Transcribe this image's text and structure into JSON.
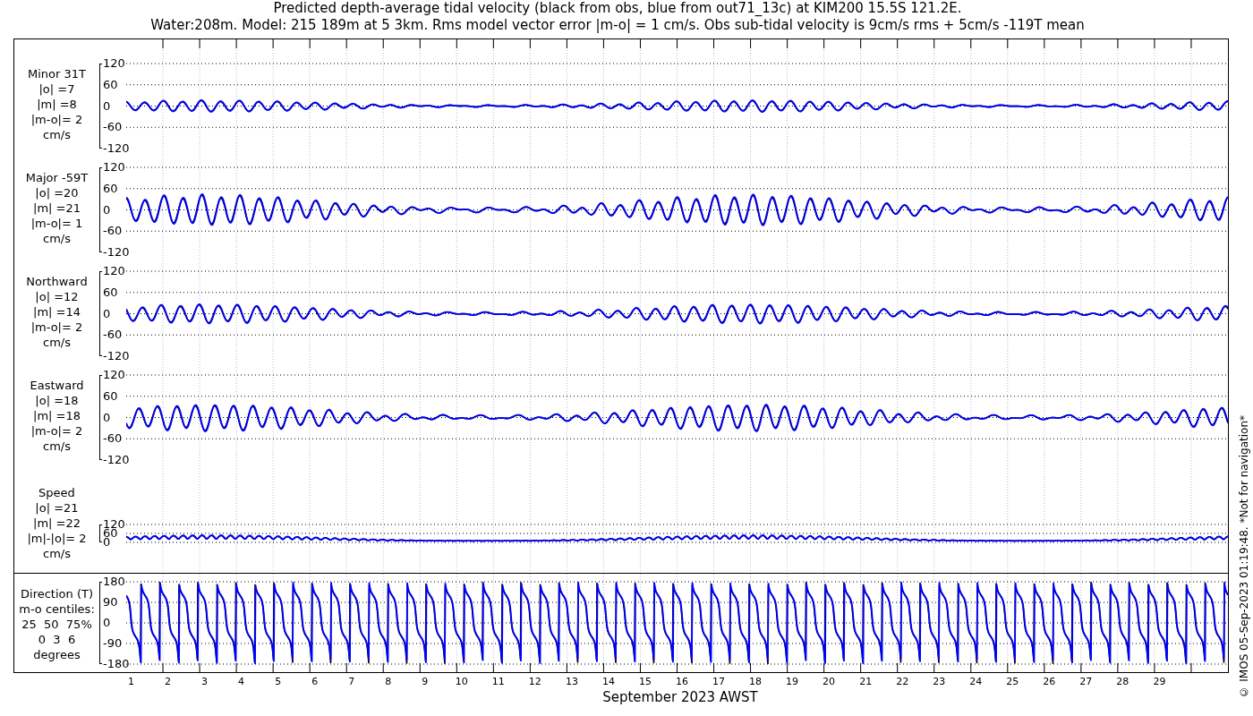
{
  "title": [
    "Predicted depth-average tidal velocity (black from obs, blue from out71_13c) at KIM200 15.5S 121.2E.",
    "Water:208m. Model: 215 189m at 5 3km. Rms model vector error |m-o| = 1 cm/s. Obs sub-tidal velocity is 9cm/s rms + 5cm/s -119T mean"
  ],
  "panels": [
    {
      "kind": "component",
      "label": [
        "Minor 31T",
        "|o| =7",
        "|m| =8",
        "|m-o|= 2",
        "cm/s"
      ],
      "yticks": [
        "120",
        "60",
        "0",
        "-60",
        "-120"
      ]
    },
    {
      "kind": "component",
      "label": [
        "Major -59T",
        "|o| =20",
        "|m| =21",
        "|m-o|= 1",
        "cm/s"
      ],
      "yticks": [
        "120",
        "60",
        "0",
        "-60",
        "-120"
      ]
    },
    {
      "kind": "component",
      "label": [
        "Northward",
        "|o| =12",
        "|m| =14",
        "|m-o|= 2",
        "cm/s"
      ],
      "yticks": [
        "120",
        "60",
        "0",
        "-60",
        "-120"
      ]
    },
    {
      "kind": "component",
      "label": [
        "Eastward",
        "|o| =18",
        "|m| =18",
        "|m-o|= 2",
        "cm/s"
      ],
      "yticks": [
        "120",
        "60",
        "0",
        "-60",
        "-120"
      ]
    },
    {
      "kind": "speed",
      "label": [
        "Speed",
        "|o| =21",
        "|m| =22",
        "|m|-|o|= 2",
        "cm/s"
      ],
      "yticks": [
        "120",
        "60",
        "0"
      ]
    },
    {
      "kind": "direction",
      "label": [
        "Direction (T)",
        "m-o centiles:",
        "25  50  75%",
        "0  3  6",
        "degrees"
      ],
      "yticks": [
        "180",
        "90",
        "0",
        "-90",
        "-180"
      ]
    }
  ],
  "xticks": [
    "1",
    "2",
    "3",
    "4",
    "5",
    "6",
    "7",
    "8",
    "9",
    "10",
    "11",
    "12",
    "13",
    "14",
    "15",
    "16",
    "17",
    "18",
    "19",
    "20",
    "21",
    "22",
    "23",
    "24",
    "25",
    "26",
    "27",
    "28",
    "29"
  ],
  "xlabel": "September 2023 AWST",
  "credit": "© IMOS 05-Sep-2023 01:19:48. *Not for navigation*"
}
